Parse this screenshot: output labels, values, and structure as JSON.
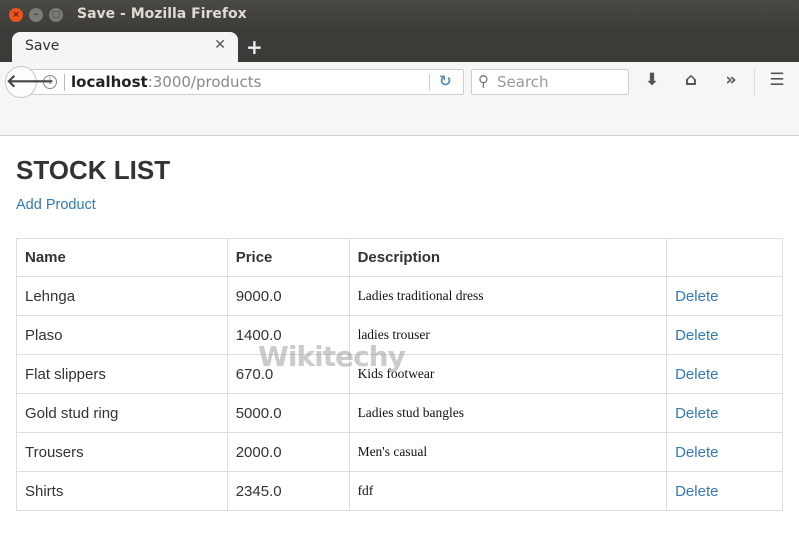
{
  "window": {
    "title": "Save - Mozilla Firefox",
    "controls": {
      "close": "×",
      "minimize": "–",
      "maximize": "▢"
    }
  },
  "tabs": [
    {
      "label": "Save",
      "close_glyph": "✕"
    }
  ],
  "new_tab_glyph": "+",
  "navbar": {
    "back_glyph": "🡐",
    "info_glyph": "i",
    "url_host": "localhost",
    "url_rest": ":3000/products",
    "reload_glyph": "↻",
    "search_placeholder": "Search",
    "search_glyph": "⚲",
    "download_glyph": "⬇",
    "home_glyph": "⌂",
    "overflow_glyph": "»",
    "menu_glyph": "☰"
  },
  "page": {
    "title": "STOCK LIST",
    "add_link": "Add Product",
    "table": {
      "headers": [
        "Name",
        "Price",
        "Description",
        ""
      ],
      "rows": [
        {
          "name": "Lehnga",
          "price": "9000.0",
          "description": "Ladies traditional dress",
          "action": "Delete"
        },
        {
          "name": "Plaso",
          "price": "1400.0",
          "description": "ladies trouser",
          "action": "Delete"
        },
        {
          "name": "Flat slippers",
          "price": "670.0",
          "description": "Kids footwear",
          "action": "Delete"
        },
        {
          "name": "Gold stud ring",
          "price": "5000.0",
          "description": "Ladies stud bangles",
          "action": "Delete"
        },
        {
          "name": "Trousers",
          "price": "2000.0",
          "description": "Men's casual",
          "action": "Delete"
        },
        {
          "name": "Shirts",
          "price": "2345.0",
          "description": "fdf",
          "action": "Delete"
        }
      ]
    },
    "watermark": "Wikitechy"
  }
}
